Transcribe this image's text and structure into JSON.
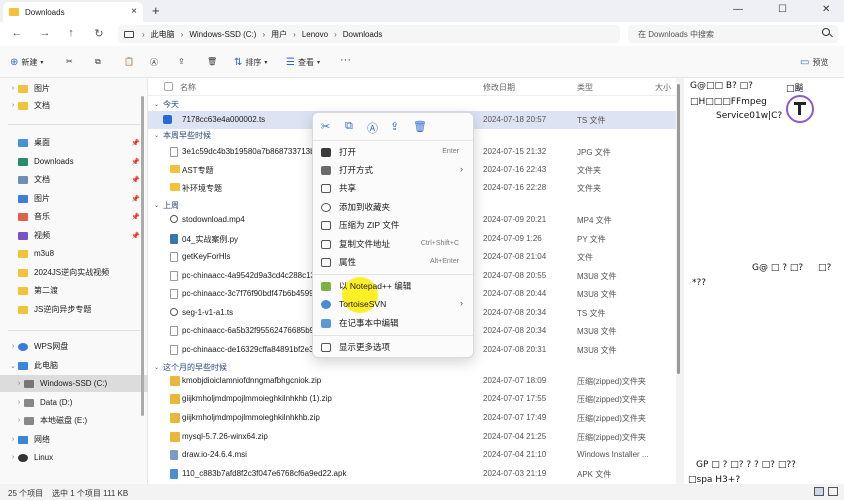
{
  "tab": {
    "title": "Downloads",
    "close": "×",
    "new": "+"
  },
  "window": {
    "min": "—",
    "max": "☐",
    "close": "✕"
  },
  "nav_buttons": {
    "back": "←",
    "forward": "→",
    "up": "↑",
    "refresh": "↻",
    "breadcrumb_sep": "›"
  },
  "breadcrumbs": [
    "此电脑",
    "Windows-SSD (C:)",
    "用户",
    "Lenovo",
    "Downloads"
  ],
  "search": {
    "placeholder": "在 Downloads 中搜索"
  },
  "toolbar": {
    "new_label": "新建",
    "sort_label": "排序",
    "view_label": "查看",
    "more_label": "···",
    "preview_label": "预览"
  },
  "sidebar": {
    "items": [
      {
        "label": "图片",
        "pin": false
      },
      {
        "label": "文档",
        "pin": false
      },
      {
        "label": "桌面",
        "pin": true
      },
      {
        "label": "Downloads",
        "pin": true
      },
      {
        "label": "文档",
        "pin": true
      },
      {
        "label": "图片",
        "pin": true
      },
      {
        "label": "音乐",
        "pin": true
      },
      {
        "label": "视频",
        "pin": true
      },
      {
        "label": "m3u8",
        "pin": false
      },
      {
        "label": "2024JS逆向实战视频",
        "pin": false
      },
      {
        "label": "第二渡",
        "pin": false
      },
      {
        "label": "JS逆向异步专题",
        "pin": false
      },
      {
        "label": "WPS网盘",
        "pin": false
      },
      {
        "label": "此电脑",
        "pin": false
      },
      {
        "label": "Windows-SSD (C:)",
        "pin": false
      },
      {
        "label": "Data (D:)",
        "pin": false
      },
      {
        "label": "本地磁盘 (E:)",
        "pin": false
      },
      {
        "label": "网络",
        "pin": false
      },
      {
        "label": "Linux",
        "pin": false
      }
    ]
  },
  "columns": {
    "name": "名称",
    "date": "修改日期",
    "type": "类型",
    "size": "大小"
  },
  "groups": {
    "today": "今天",
    "early_week": "本周早些时候",
    "last_week": "上周",
    "early_month": "这个月的早些时候"
  },
  "files": [
    {
      "name": "7178cc63e4a000002.ts",
      "date": "2024-07-18 20:57",
      "type": "TS 文件"
    },
    {
      "name": "3e1c59dc4b3b19580a7b868733713b37e",
      "date": "2024-07-15 21:32",
      "type": "JPG 文件"
    },
    {
      "name": "AST专题",
      "date": "2024-07-16 22:43",
      "type": "文件夹"
    },
    {
      "name": "补环境专题",
      "date": "2024-07-16 22:28",
      "type": "文件夹"
    },
    {
      "name": "stodownload.mp4",
      "date": "2024-07-09 20:21",
      "type": "MP4 文件"
    },
    {
      "name": "04_实战案例.py",
      "date": "2024-07-09 1:26",
      "type": "PY 文件"
    },
    {
      "name": "getKeyForHls",
      "date": "2024-07-08 21:04",
      "type": "文件"
    },
    {
      "name": "pc-chinaacc-4a9542d9a3cd4c288c1370",
      "date": "2024-07-08 20:55",
      "type": "M3U8 文件"
    },
    {
      "name": "pc-chinaacc-3c7f76f90bdf47b6b4599bc",
      "date": "2024-07-08 20:44",
      "type": "M3U8 文件"
    },
    {
      "name": "seg-1-v1-a1.ts",
      "date": "2024-07-08 20:34",
      "type": "TS 文件"
    },
    {
      "name": "pc-chinaacc-6a5b32f95562476685b933",
      "date": "2024-07-08 20:34",
      "type": "M3U8 文件"
    },
    {
      "name": "pc-chinaacc-de16329cffa84891bf2e34f",
      "date": "2024-07-08 20:31",
      "type": "M3U8 文件"
    },
    {
      "name": "kmobjdioiclamniofdnngmafbhgcniok.zip",
      "date": "2024-07-07 18:09",
      "type": "压缩(zipped)文件夹"
    },
    {
      "name": "giijkmholjmdmpojlmmoieghkilnhkhb (1).zip",
      "date": "2024-07-07 17:55",
      "type": "压缩(zipped)文件夹"
    },
    {
      "name": "giijkmholjmdmpojlmmoieghkilnhkhb.zip",
      "date": "2024-07-07 17:49",
      "type": "压缩(zipped)文件夹"
    },
    {
      "name": "mysql-5.7.26-winx64.zip",
      "date": "2024-07-04 21:25",
      "type": "压缩(zipped)文件夹"
    },
    {
      "name": "draw.io-24.6.4.msi",
      "date": "2024-07-04 21:10",
      "type": "Windows Installer ..."
    },
    {
      "name": "110_c883b7afd8f2c3f047e6768cf6a9ed22.apk",
      "date": "2024-07-03 21:19",
      "type": "APK 文件"
    }
  ],
  "context_menu": {
    "items": [
      {
        "label": "打开",
        "shortcut": "Enter"
      },
      {
        "label": "打开方式",
        "shortcut": ""
      },
      {
        "label": "共享",
        "shortcut": ""
      },
      {
        "label": "添加到收藏夹",
        "shortcut": ""
      },
      {
        "label": "压缩为 ZIP 文件",
        "shortcut": ""
      },
      {
        "label": "复制文件地址",
        "shortcut": "Ctrl+Shift+C"
      },
      {
        "label": "属性",
        "shortcut": "Alt+Enter"
      },
      {
        "label": "以 Notepad++ 编辑",
        "shortcut": ""
      },
      {
        "label": "TortoiseSVN",
        "shortcut": ""
      },
      {
        "label": "在记事本中编辑",
        "shortcut": ""
      },
      {
        "label": "显示更多选项",
        "shortcut": ""
      }
    ],
    "submenu_arrow": "›"
  },
  "preview_text": {
    "l1": "G@□□ B? □?",
    "l1b": "□飈",
    "l2": "□H□□□FFmpeg",
    "l3": "Service01w|C?",
    "l4": "G@ □ ? □?",
    "l4b": "□?",
    "l5": "*??",
    "l6": "GP □ ? □? ? ? □? □??",
    "l7": "□spa H3+?"
  },
  "status": {
    "count": "25 个项目",
    "selected": "选中 1 个项目  111 KB"
  }
}
